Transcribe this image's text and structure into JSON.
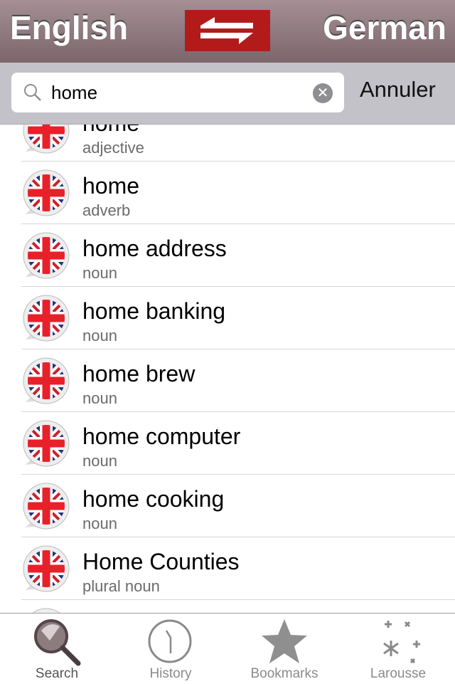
{
  "header": {
    "source_lang": "English",
    "target_lang": "German",
    "swap_icon": "swap-arrows-icon",
    "accent": "#b31b1b"
  },
  "search": {
    "value": "home",
    "placeholder": "",
    "cancel_label": "Annuler"
  },
  "results": [
    {
      "word": "home",
      "pos": "adjective"
    },
    {
      "word": "home",
      "pos": "adverb"
    },
    {
      "word": "home address",
      "pos": "noun"
    },
    {
      "word": "home banking",
      "pos": "noun"
    },
    {
      "word": "home brew",
      "pos": "noun"
    },
    {
      "word": "home computer",
      "pos": "noun"
    },
    {
      "word": "home cooking",
      "pos": "noun"
    },
    {
      "word": "Home Counties",
      "pos": "plural noun"
    },
    {
      "word": "",
      "pos": ""
    }
  ],
  "tabs": [
    {
      "label": "Search",
      "icon": "magnifier-icon",
      "active": true
    },
    {
      "label": "History",
      "icon": "clock-icon"
    },
    {
      "label": "Bookmarks",
      "icon": "star-icon"
    },
    {
      "label": "Larousse",
      "icon": "sparkle-icon"
    }
  ]
}
